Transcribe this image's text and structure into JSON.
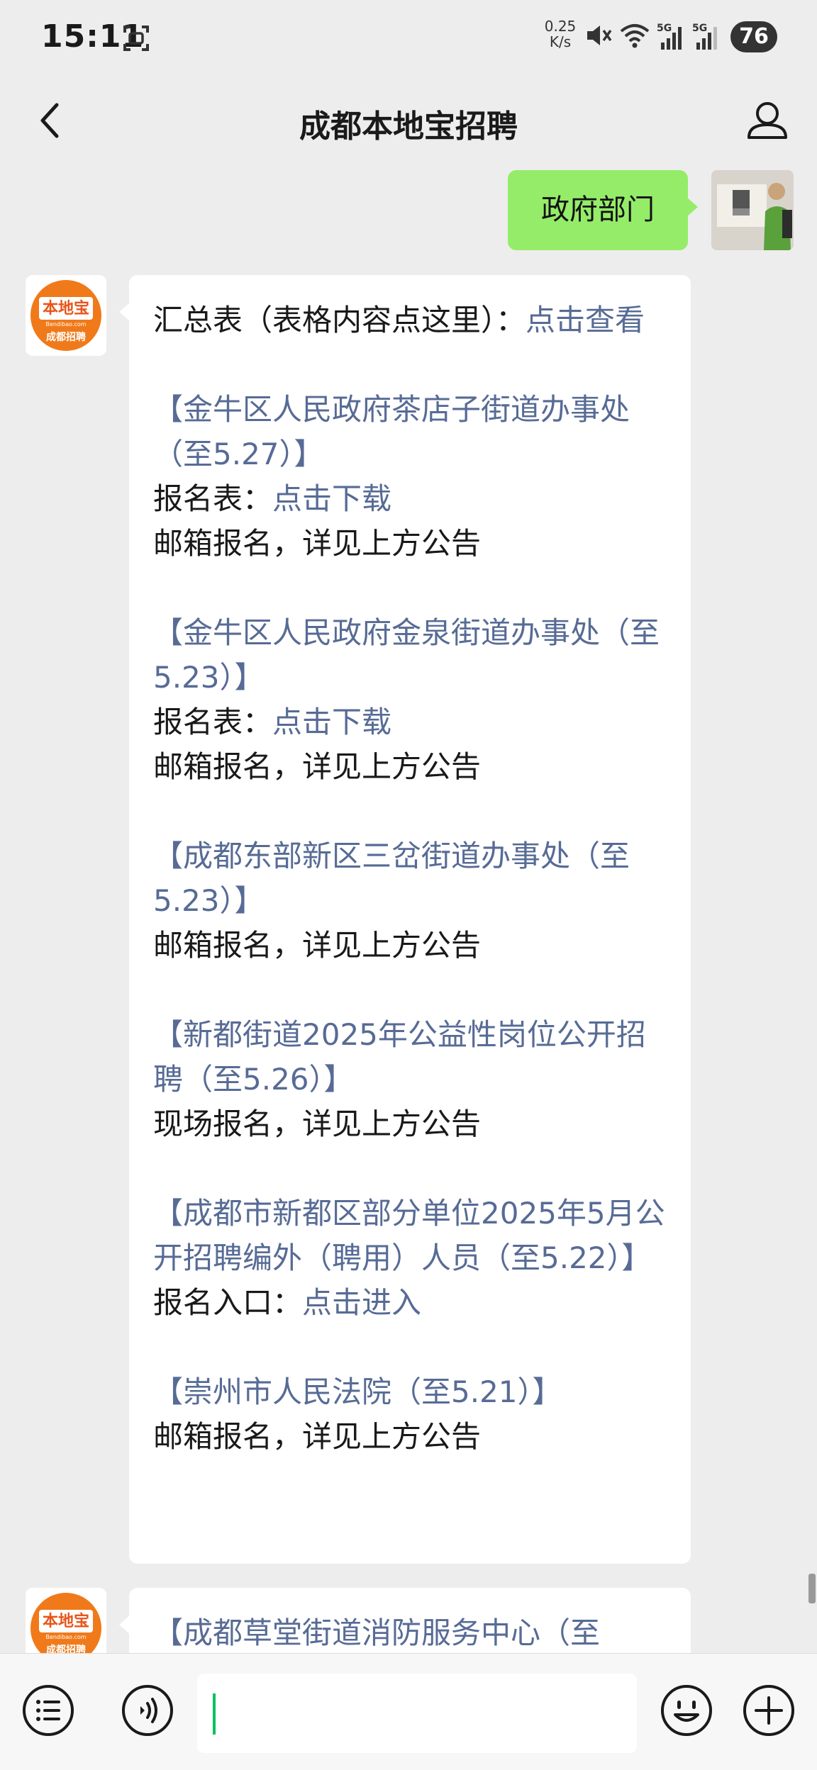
{
  "status_bar": {
    "time": "15:11",
    "net_speed_value": "0.25",
    "net_speed_unit": "K/s",
    "battery": "76"
  },
  "nav": {
    "title": "成都本地宝招聘"
  },
  "outgoing_message": {
    "text": "政府部门"
  },
  "sender_logo": {
    "name": "本地宝",
    "domain": "Bendibao.com",
    "label": "成都招聘"
  },
  "message": {
    "summary_label": "汇总表（表格内容点这里）：",
    "summary_link": "点击查看",
    "entries": [
      {
        "title": "【金牛区人民政府茶店子街道办事处（至5.27）】",
        "form_label": "报名表：",
        "form_link": "点击下载",
        "note": "邮箱报名，详见上方公告"
      },
      {
        "title": "【金牛区人民政府金泉街道办事处（至5.23）】",
        "form_label": "报名表：",
        "form_link": "点击下载",
        "note": "邮箱报名，详见上方公告"
      },
      {
        "title": "【成都东部新区三岔街道办事处（至5.23）】",
        "note": "邮箱报名，详见上方公告"
      },
      {
        "title": "【新都街道2025年公益性岗位公开招聘（至5.26）】",
        "note": "现场报名，详见上方公告"
      },
      {
        "title": "【成都市新都区部分单位2025年5月公开招聘编外（聘用）人员（至5.22）】",
        "form_label": "报名入口：",
        "form_link": "点击进入"
      },
      {
        "title": "【崇州市人民法院（至5.21）】",
        "note": "邮箱报名，详见上方公告"
      }
    ]
  },
  "next_message": {
    "title": "【成都草堂街道消防服务中心（至"
  },
  "icons": {
    "status": [
      "screenshot-icon",
      "mute-icon",
      "wifi-icon",
      "signal-icon",
      "signal-icon"
    ],
    "nav": [
      "back-icon",
      "user-icon"
    ],
    "bottom": [
      "menu-icon",
      "voice-icon",
      "emoji-icon",
      "plus-icon"
    ]
  },
  "colors": {
    "link": "#576b95",
    "outgoing_bubble": "#95ec69",
    "logo_orange": "#f07a1a",
    "cursor": "#07c160"
  }
}
